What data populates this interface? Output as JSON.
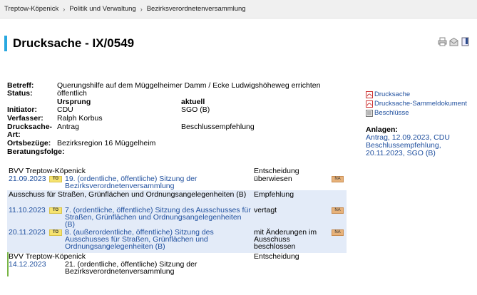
{
  "breadcrumb": [
    "Treptow-Köpenick",
    "Politik und Verwaltung",
    "Bezirksverordnetenversammlung"
  ],
  "title": "Drucksache - IX/0549",
  "meta": {
    "betreff_label": "Betreff:",
    "betreff": "Querungshilfe auf dem Müggelheimer Damm / Ecke Ludwigshöheweg errichten",
    "status_label": "Status:",
    "status": "öffentlich",
    "ursprung_header": "Ursprung",
    "aktuell_header": "aktuell",
    "initiator_label": "Initiator:",
    "initiator_ursprung": "CDU",
    "initiator_aktuell": "SGO (B)",
    "verfasser_label": "Verfasser:",
    "verfasser": "Ralph Korbus",
    "art_label_1": "Drucksache-",
    "art_label_2": "Art:",
    "art_ursprung": "Antrag",
    "art_aktuell": "Beschlussempfehlung",
    "ortsbezuege_label": "Ortsbezüge:",
    "ortsbezuege": "Bezirksregion 16 Müggelheim",
    "beratungsfolge_label": "Beratungsfolge:"
  },
  "documents": [
    {
      "label": "Drucksache",
      "icon": "pdf-icon"
    },
    {
      "label": "Drucksache-Sammeldokument",
      "icon": "pdf-icon"
    },
    {
      "label": "Beschlüsse",
      "icon": "document-icon"
    }
  ],
  "anlagen": {
    "title": "Anlagen:",
    "lines": [
      "Antrag, 12.09.2023, CDU",
      "Beschlussempfehlung,",
      "20.11.2023, SGO (B)"
    ]
  },
  "beratungsfolge": {
    "to_label": "TO",
    "na_label": "NA",
    "groups": [
      {
        "gremium": "BVV Treptow-Köpenick",
        "role": "Entscheidung",
        "sessions": [
          {
            "date": "21.09.2023",
            "session": "19. (ordentliche, öffentliche) Sitzung der Bezirksverordnetenversammlung",
            "result": "überwiesen"
          }
        ]
      },
      {
        "gremium": "Ausschuss für Straßen, Grünflächen und Ordnungsangelegenheiten (B)",
        "role": "Empfehlung",
        "sessions": [
          {
            "date": "11.10.2023",
            "session": "7. (ordentliche, öffentliche) Sitzung des Ausschusses für Straßen, Grünflächen und Ordnungsangelegenheiten (B)",
            "result": "vertagt"
          },
          {
            "date": "20.11.2023",
            "session": "8. (außerordentliche, öffentliche) Sitzung des Ausschusses für Straßen, Grünflächen und Ordnungsangelegenheiten (B)",
            "result": "mit Änderungen im Ausschuss beschlossen"
          }
        ]
      },
      {
        "gremium": "BVV Treptow-Köpenick",
        "role": "Entscheidung",
        "sessions": [
          {
            "date": "14.12.2023",
            "session": "21. (ordentliche, öffentliche) Sitzung der Bezirksverordnetenversammlung",
            "result": ""
          }
        ]
      }
    ]
  },
  "colors": {
    "accent": "#29a8e0",
    "link": "#1f4f9e",
    "shade": "#e3ebf8",
    "to_badge": "#f6e36f",
    "na_badge": "#e7b27a",
    "upcoming": "#78b545"
  }
}
